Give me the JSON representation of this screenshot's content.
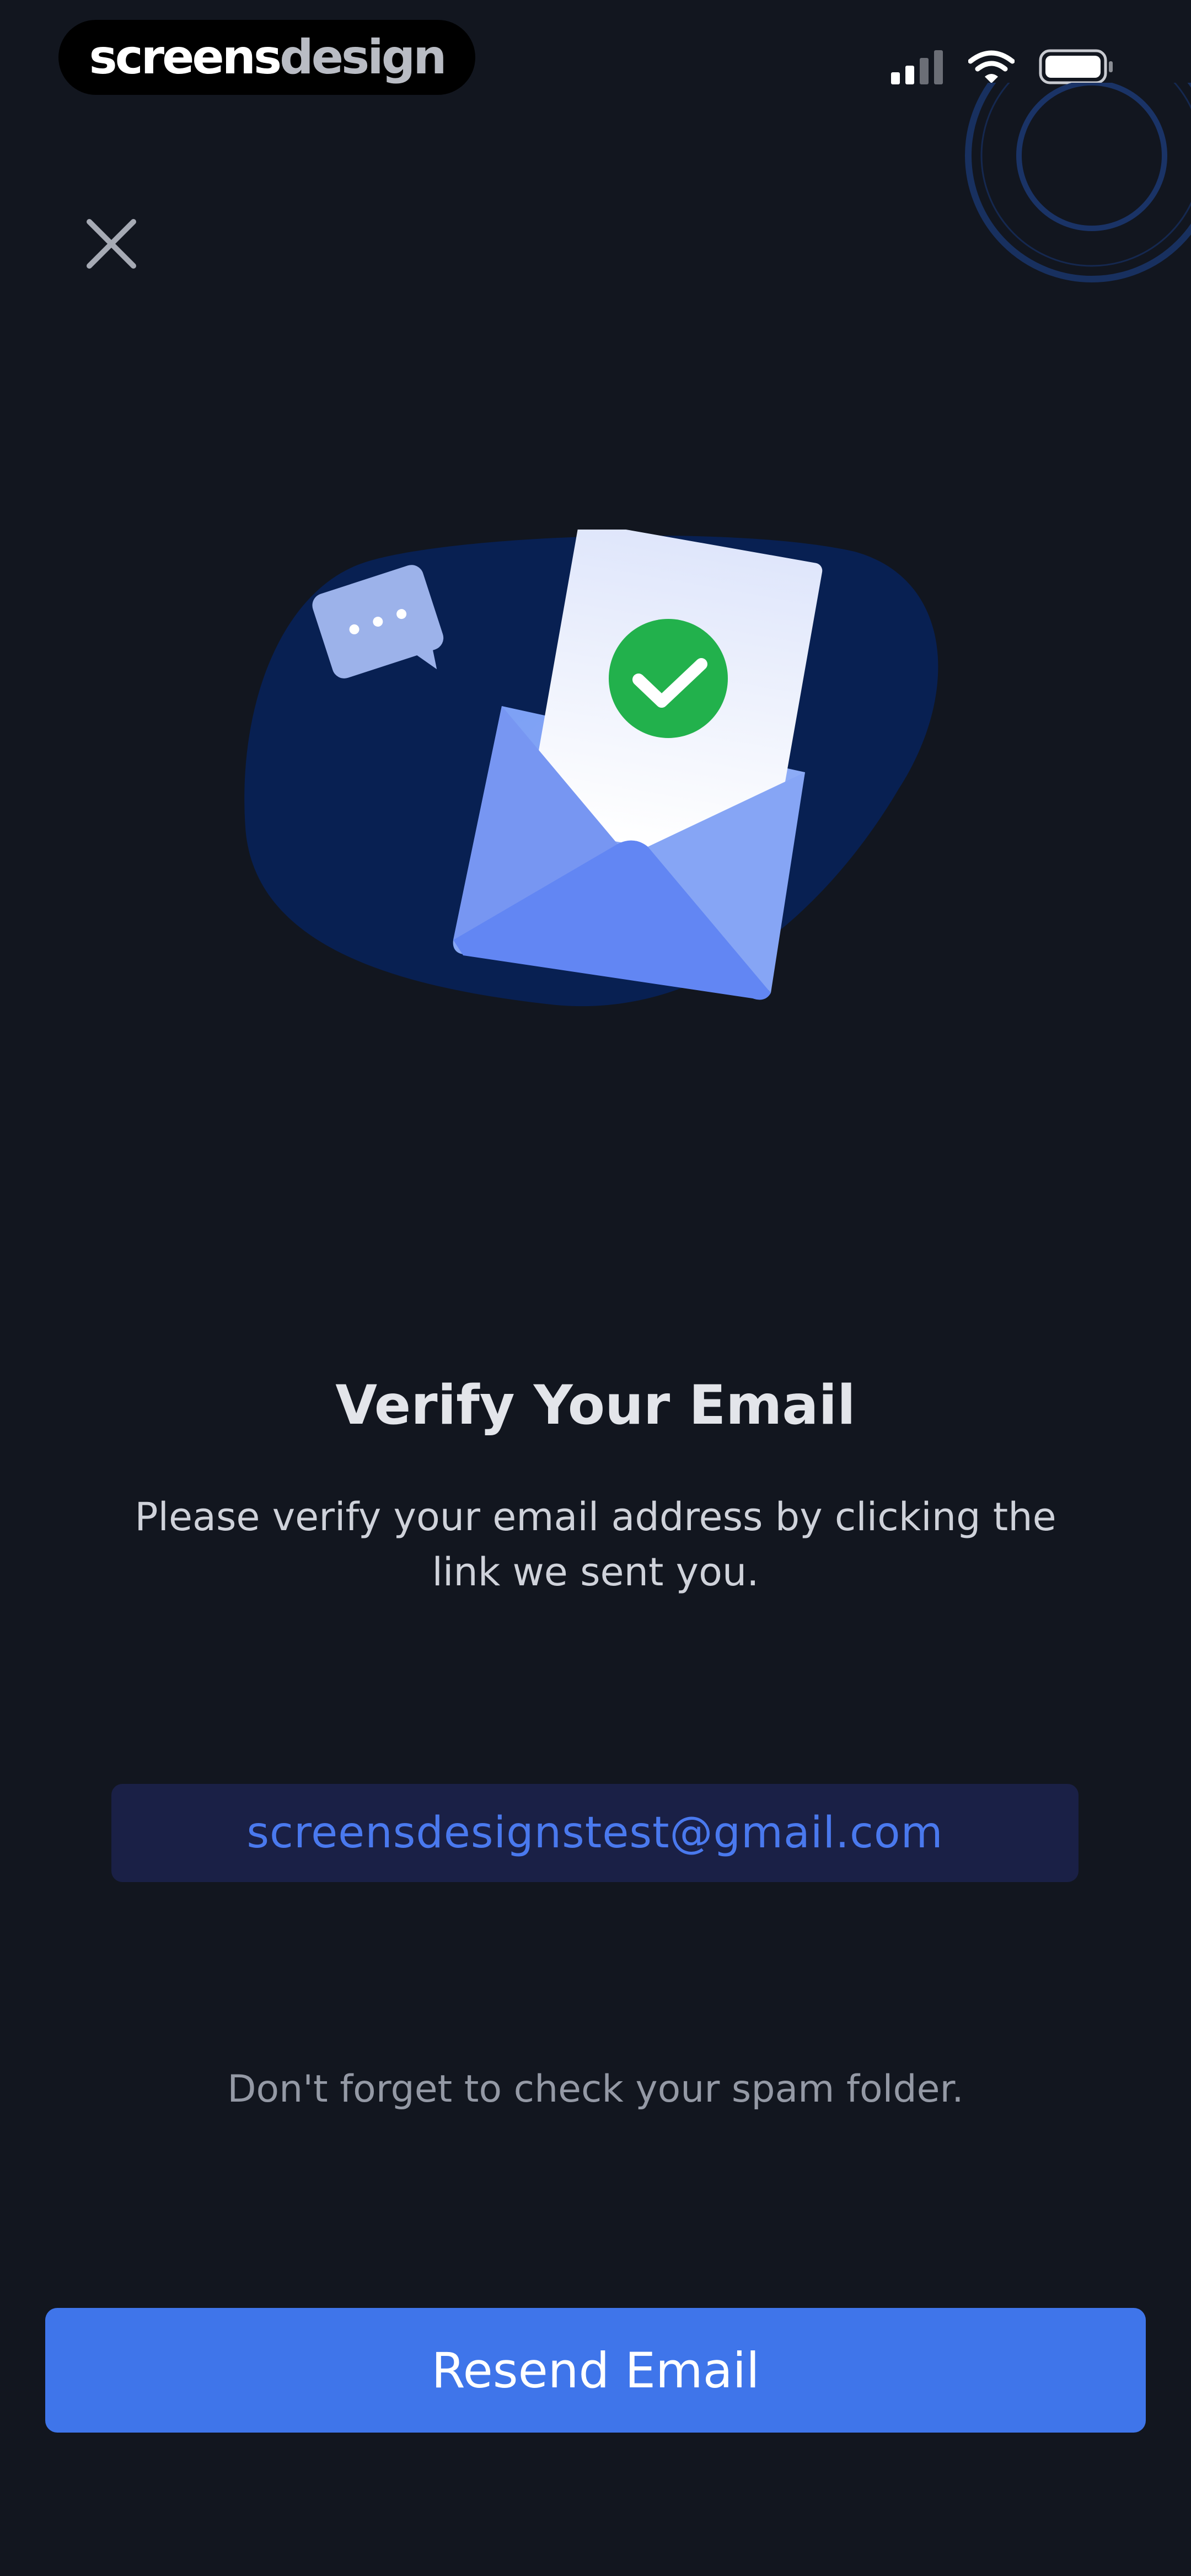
{
  "status_bar": {
    "brand_part1": "screens",
    "brand_part2": "design",
    "icons": [
      "cellular-signal-icon",
      "wifi-icon",
      "battery-icon"
    ]
  },
  "header": {
    "close_icon": "close-icon"
  },
  "illustration": {
    "name": "envelope-verified-illustration",
    "icons": [
      "chat-bubble-icon",
      "checkmark-icon",
      "envelope-icon"
    ]
  },
  "main": {
    "title": "Verify Your Email",
    "subtitle": "Please verify your email address by clicking the link we sent you.",
    "email": "screensdesignstest@gmail.com",
    "spam_note": "Don't forget to check your spam folder."
  },
  "actions": {
    "resend_label": "Resend Email"
  },
  "colors": {
    "background": "#12161f",
    "accent": "#3f75ea",
    "email_text": "#4a79ee",
    "email_box": "#1a2046",
    "success": "#22b14c"
  }
}
